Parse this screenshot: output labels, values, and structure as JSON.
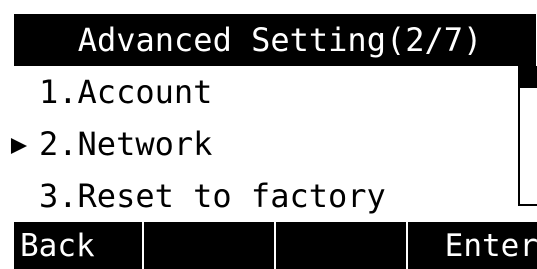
{
  "title": "Advanced Setting(2/7)",
  "menu": {
    "items": [
      {
        "label": "1.Account",
        "selected": false
      },
      {
        "label": "2.Network",
        "selected": true
      },
      {
        "label": "3.Reset to factory",
        "selected": false
      }
    ],
    "selected_index": 1
  },
  "softkeys": [
    "Back",
    "",
    "",
    "Enter"
  ],
  "colors": {
    "background": "#ffffff",
    "foreground": "#000000",
    "inverse_text": "#ffffff"
  },
  "icons": {
    "selection_pointer": "right-triangle-icon",
    "scroll_thumb": "scroll-thumb"
  }
}
